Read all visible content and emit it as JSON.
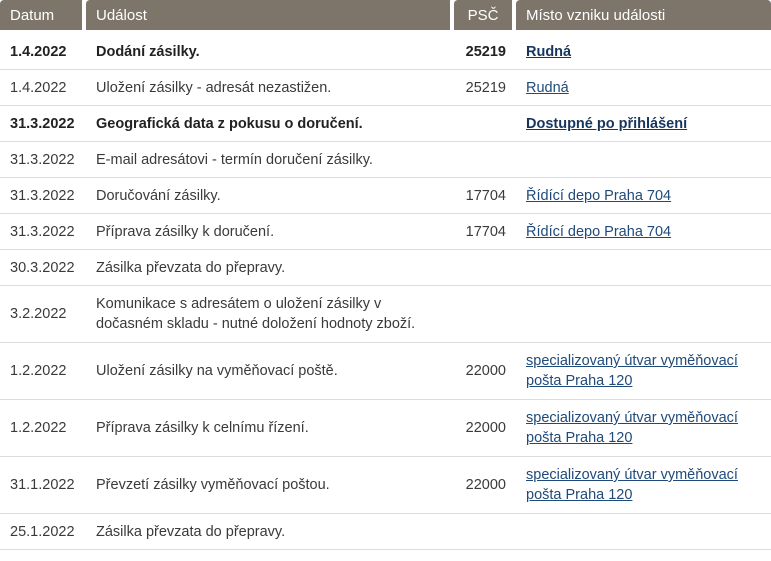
{
  "header": {
    "date": "Datum",
    "event": "Událost",
    "psc": "PSČ",
    "place": "Místo vzniku události"
  },
  "rows": [
    {
      "date": "1.4.2022",
      "event": "Dodání zásilky.",
      "psc": "25219",
      "place": "Rudná",
      "bold": true
    },
    {
      "date": "1.4.2022",
      "event": "Uložení zásilky - adresát nezastižen.",
      "psc": "25219",
      "place": "Rudná"
    },
    {
      "date": "31.3.2022",
      "event": "Geografická data z pokusu o doručení.",
      "psc": "",
      "place": "Dostupné po přihlášení",
      "bold": true
    },
    {
      "date": "31.3.2022",
      "event": "E-mail adresátovi - termín doručení zásilky.",
      "psc": "",
      "place": ""
    },
    {
      "date": "31.3.2022",
      "event": "Doručování zásilky.",
      "psc": "17704",
      "place": "Řídící depo Praha 704"
    },
    {
      "date": "31.3.2022",
      "event": "Příprava zásilky k doručení.",
      "psc": "17704",
      "place": "Řídící depo Praha 704"
    },
    {
      "date": "30.3.2022",
      "event": "Zásilka převzata do přepravy.",
      "psc": "",
      "place": ""
    },
    {
      "date": "3.2.2022",
      "event": "Komunikace s adresátem o uložení zásilky v dočasném skladu - nutné doložení hodnoty zboží.",
      "psc": "",
      "place": ""
    },
    {
      "date": "1.2.2022",
      "event": "Uložení zásilky na vyměňovací poště.",
      "psc": "22000",
      "place": "specializovaný útvar vyměňovací pošta Praha 120"
    },
    {
      "date": "1.2.2022",
      "event": "Příprava zásilky k celnímu řízení.",
      "psc": "22000",
      "place": "specializovaný útvar vyměňovací pošta Praha 120"
    },
    {
      "date": "31.1.2022",
      "event": "Převzetí zásilky vyměňovací poštou.",
      "psc": "22000",
      "place": "specializovaný útvar vyměňovací pošta Praha 120"
    },
    {
      "date": "25.1.2022",
      "event": "Zásilka převzata do přepravy.",
      "psc": "",
      "place": ""
    }
  ]
}
